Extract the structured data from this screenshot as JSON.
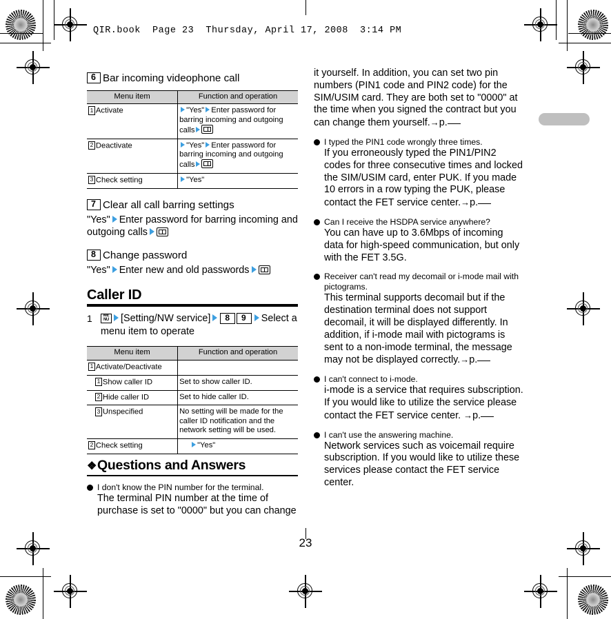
{
  "print_header": "QIR.book  Page 23  Thursday, April 17, 2008  3:14 PM",
  "page_number": "23",
  "colors": {
    "arrow_blue": "#3d9fe0",
    "table_header_gray": "#d2d2d2",
    "thumb_tab_gray": "#bfbfbf"
  },
  "left_column": {
    "section_6": {
      "number": "6",
      "title": "Bar incoming videophone call",
      "table": {
        "headers": [
          "Menu item",
          "Function and operation"
        ],
        "rows": [
          {
            "num": "1",
            "item": "Activate",
            "op_pre": "\"Yes\"",
            "op_mid": "Enter password for barring incoming and outgoing calls",
            "icon": "phonebook-book-icon"
          },
          {
            "num": "2",
            "item": "Deactivate",
            "op_pre": "\"Yes\"",
            "op_mid": "Enter password for barring incoming and outgoing calls",
            "icon": "phonebook-book-icon"
          },
          {
            "num": "3",
            "item": "Check setting",
            "op_pre": "\"Yes\"",
            "op_mid": "",
            "icon": ""
          }
        ]
      }
    },
    "section_7": {
      "number": "7",
      "title": "Clear all call barring settings",
      "body_pre": "\"Yes\"",
      "body_mid": "Enter password for barring incoming and outgoing calls",
      "icon": "phonebook-book-icon"
    },
    "section_8": {
      "number": "8",
      "title": "Change password",
      "body_pre": "\"Yes\"",
      "body_mid": "Enter new and old passwords",
      "icon": "phonebook-book-icon"
    },
    "caller_id": {
      "heading": "Caller ID",
      "step_number": "1",
      "step_icon": "menu-key-icon",
      "step_text_1": "[Setting/NW service]",
      "key_1": "8",
      "key_2": "9",
      "step_text_2": "Select a menu item to operate",
      "table": {
        "headers": [
          "Menu item",
          "Function and operation"
        ],
        "rows": [
          {
            "num": "1",
            "item": "Activate/Deactivate",
            "op": "",
            "indent": false
          },
          {
            "num": "1",
            "item": "Show caller ID",
            "op": "Set to show caller ID.",
            "indent": true
          },
          {
            "num": "2",
            "item": "Hide caller ID",
            "op": "Set to hide caller ID.",
            "indent": true
          },
          {
            "num": "3",
            "item": "Unspecified",
            "op": "No setting will be made for the caller ID notification and the network setting will be used.",
            "indent": true
          },
          {
            "num": "2",
            "item": "Check setting",
            "op": "\"Yes\"",
            "indent": false,
            "op_has_arrow": true
          }
        ]
      }
    },
    "qa_heading": "Questions and Answers",
    "qa_first": {
      "question": "I don't know the PIN number for the terminal.",
      "answer": "The terminal PIN number at the time of purchase is set to \"0000\" but you can change"
    }
  },
  "right_column": {
    "qa_first_continued": "it yourself. In addition, you can set two pin numbers (PIN1 code and PIN2 code) for the SIM/USIM card. They are both set to \"0000\" at the time when you signed the contract but you can change them yourself.",
    "qa_first_ref": "p.",
    "items": [
      {
        "question": "I typed the PIN1 code wrongly three times.",
        "answer": "If you erroneously typed the PIN1/PIN2 codes for three consecutive times and locked the SIM/USIM card, enter PUK. If you made 10 errors in a row typing the PUK, please contact the FET service center.",
        "ref": "p.",
        "has_ref": true
      },
      {
        "question": "Can I receive the HSDPA service anywhere?",
        "answer": "You can have up to 3.6Mbps of incoming data for high-speed communication, but only with the FET 3.5G.",
        "ref": "",
        "has_ref": false
      },
      {
        "question": "Receiver can't read my decomail or i-mode mail with pictograms.",
        "answer": "This terminal supports decomail but if the destination terminal does not support decomail, it will be displayed differently. In addition, if i-mode mail with pictograms is sent to a non-imode terminal, the message may not be displayed correctly.",
        "ref": "p.",
        "has_ref": true
      },
      {
        "question": "I can't connect to i-mode.",
        "answer": "i-mode is a service that requires subscription. If you would like to utilize the service please contact the FET service center. ",
        "ref": "p.",
        "has_ref": true
      },
      {
        "question": "I can't use the answering machine.",
        "answer": "Network services such as voicemail require subscription. If you would like to utilize these services please contact the FET service center.",
        "ref": "",
        "has_ref": false
      }
    ]
  }
}
